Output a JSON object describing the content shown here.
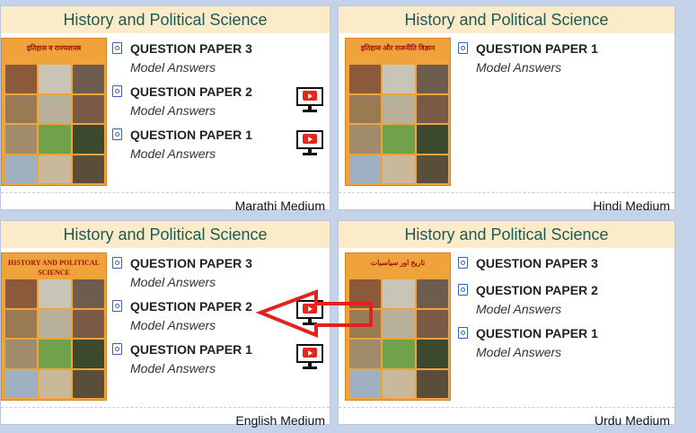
{
  "cards": [
    {
      "header": "History and Political Science",
      "cover_title": "इतिहास व राज्यशास्त्र",
      "papers": [
        {
          "title": "QUESTION PAPER 3",
          "subtitle": "Model Answers"
        },
        {
          "title": "QUESTION PAPER 2",
          "subtitle": "Model Answers"
        },
        {
          "title": "QUESTION PAPER 1",
          "subtitle": "Model Answers"
        }
      ],
      "medium": "Marathi Medium"
    },
    {
      "header": "History and Political Science",
      "cover_title": "इतिहास और राजनीति विज्ञान",
      "papers": [
        {
          "title": "QUESTION PAPER 1",
          "subtitle": "Model Answers"
        }
      ],
      "medium": "Hindi Medium"
    },
    {
      "header": "History and Political Science",
      "cover_title": "HISTORY AND POLITICAL SCIENCE",
      "papers": [
        {
          "title": "QUESTION PAPER 3",
          "subtitle": "Model Answers"
        },
        {
          "title": "QUESTION PAPER 2",
          "subtitle": "Model Answers"
        },
        {
          "title": "QUESTION PAPER 1",
          "subtitle": "Model Answers"
        }
      ],
      "medium": "English Medium"
    },
    {
      "header": "History and Political Science",
      "cover_title": "تاریخ اور سیاسیات",
      "papers": [
        {
          "title": "QUESTION PAPER 3",
          "subtitle": ""
        },
        {
          "title": "QUESTION PAPER 2",
          "subtitle": "Model Answers"
        },
        {
          "title": "QUESTION PAPER 1",
          "subtitle": "Model Answers"
        }
      ],
      "medium": "Urdu Medium"
    }
  ],
  "colors": {
    "page_bg": "#c5d3ea",
    "header_bg": "#fcebc9",
    "header_text": "#1d5a55",
    "arrow": "#e0231e",
    "video_red": "#e4261c"
  },
  "icons": {
    "paper": "pdf-file-icon",
    "video": "video-monitor-icon"
  }
}
